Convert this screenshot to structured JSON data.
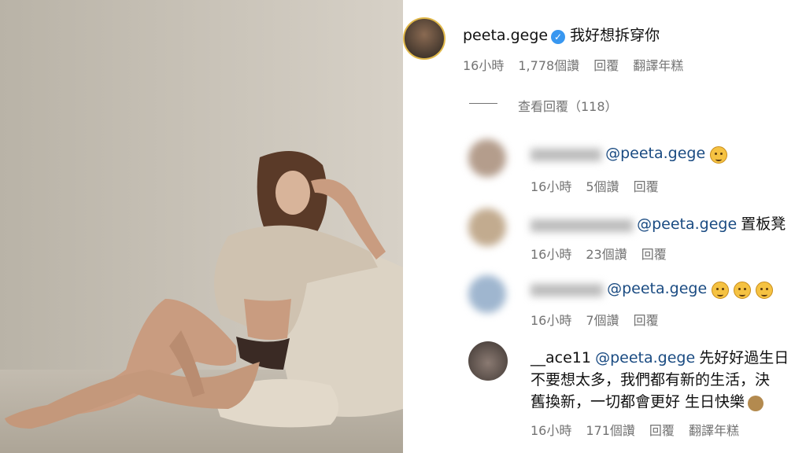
{
  "post": {
    "image_alt": "photo"
  },
  "thread": {
    "main": {
      "username": "peeta.gege",
      "verified_icon": "verified-badge-icon",
      "text": "我好想拆穿你",
      "time": "16小時",
      "likes": "1,778個讚",
      "reply": "回覆",
      "translate": "翻譯年糕"
    },
    "view_replies": "查看回覆（118）",
    "replies": [
      {
        "mention": "@peeta.gege",
        "text": "",
        "emoji": "thinking-face-emoji",
        "time": "16小時",
        "likes": "5個讚",
        "reply": "回覆"
      },
      {
        "mention": "@peeta.gege",
        "text": "置板凳",
        "time": "16小時",
        "likes": "23個讚",
        "reply": "回覆"
      },
      {
        "mention": "@peeta.gege",
        "text": "",
        "emoji": "thinking-face-emoji",
        "time": "16小時",
        "likes": "7個讚",
        "reply": "回覆"
      },
      {
        "username": "__ace11",
        "mention": "@peeta.gege",
        "text_line1": "先好好過生日",
        "text_line2": "不要想太多，我們都有新的生活，決",
        "text_line3": "舊換新，一切都會更好 生日快樂",
        "time": "16小時",
        "likes": "171個讚",
        "reply": "回覆",
        "translate": "翻譯年糕"
      }
    ]
  },
  "colors": {
    "mention": "#1a4b82",
    "meta": "#737373",
    "verified": "#3897f0"
  }
}
